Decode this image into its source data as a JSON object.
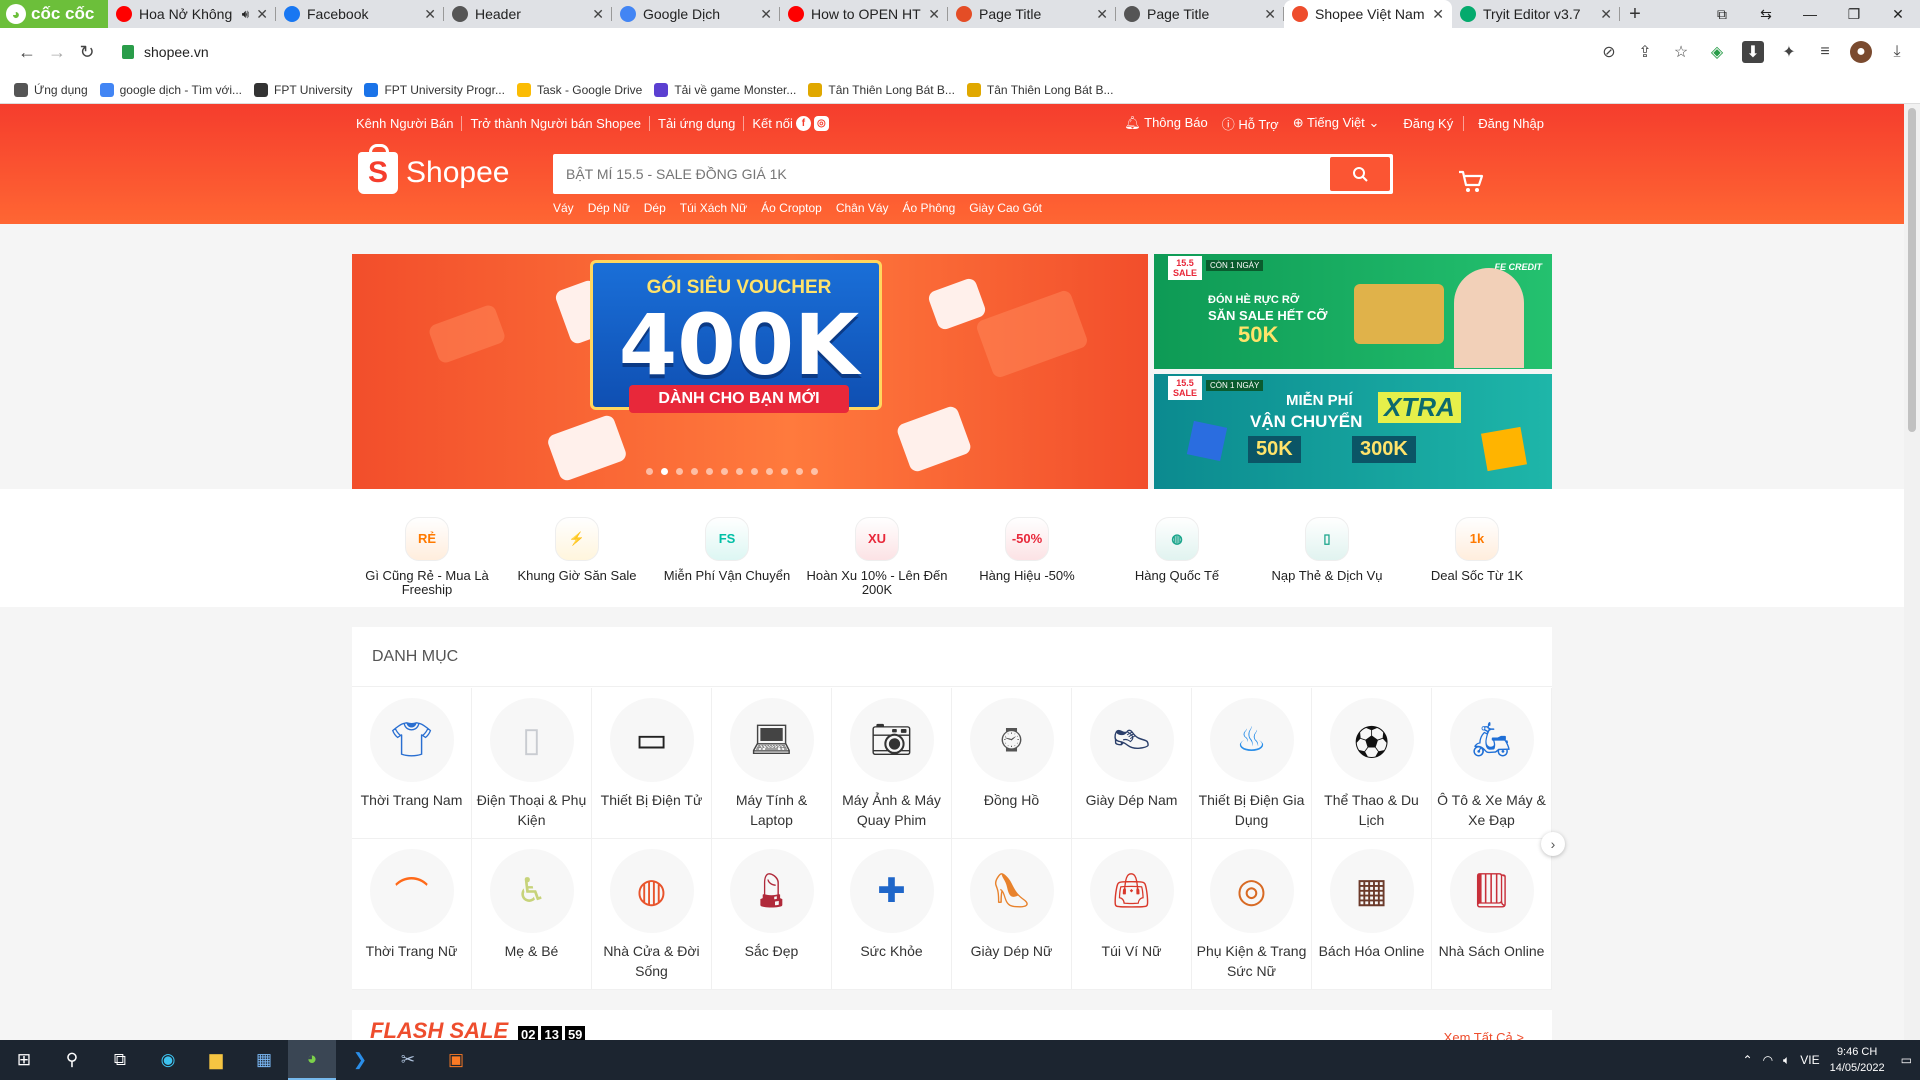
{
  "browser": {
    "brand": "cốc cốc",
    "tabs": [
      {
        "title": "Hoa Nở Không",
        "icon": "youtube-icon",
        "color": "#ff0000",
        "audio": true
      },
      {
        "title": "Facebook",
        "icon": "facebook-icon",
        "color": "#1877f2"
      },
      {
        "title": "Header",
        "icon": "globe-icon",
        "color": "#555555"
      },
      {
        "title": "Google Dịch",
        "icon": "google-translate-icon",
        "color": "#4285f4"
      },
      {
        "title": "How to OPEN HT",
        "icon": "youtube-icon",
        "color": "#ff0000"
      },
      {
        "title": "Page Title",
        "icon": "html-icon",
        "color": "#e44d26"
      },
      {
        "title": "Page Title",
        "icon": "globe-icon",
        "color": "#555555"
      },
      {
        "title": "Shopee Việt Nam",
        "icon": "shopee-icon",
        "color": "#ee4d2d",
        "active": true
      },
      {
        "title": "Tryit Editor v3.7",
        "icon": "w3schools-icon",
        "color": "#04aa6d"
      }
    ],
    "url": "shopee.vn",
    "bookmarks": [
      {
        "label": "Ứng dụng",
        "color": "#555555"
      },
      {
        "label": "google dịch - Tìm với...",
        "color": "#4285f4"
      },
      {
        "label": "FPT University",
        "color": "#333333"
      },
      {
        "label": "FPT University Progr...",
        "color": "#1a73e8"
      },
      {
        "label": "Task - Google Drive",
        "color": "#fbbc04"
      },
      {
        "label": "Tải về game Monster...",
        "color": "#5b3fd1"
      },
      {
        "label": "Tân Thiên Long Bát B...",
        "color": "#e0a800"
      },
      {
        "label": "Tân Thiên Long Bát B...",
        "color": "#e0a800"
      }
    ]
  },
  "shopee": {
    "topnav_left": [
      "Kênh Người Bán",
      "Trở thành Người bán Shopee",
      "Tải ứng dụng",
      "Kết nối"
    ],
    "topnav_right": {
      "notify": "Thông Báo",
      "help": "Hỗ Trợ",
      "lang": "Tiếng Việt",
      "register": "Đăng Ký",
      "login": "Đăng Nhập"
    },
    "logo_text": "Shopee",
    "search_placeholder": "BẬT MÍ 15.5 - SALE ĐỒNG GIÁ 1K",
    "keywords": [
      "Váy",
      "Dép Nữ",
      "Dép",
      "Túi Xách Nữ",
      "Áo Croptop",
      "Chân Váy",
      "Áo Phông",
      "Giày Cao Gót"
    ],
    "brand_color": "#ee4d2d"
  },
  "banners": {
    "main": {
      "title": "GÓI SIÊU VOUCHER",
      "amount": "400K",
      "subtitle": "DÀNH CHO BẠN MỚI",
      "dots": 12,
      "active_dot": 1
    },
    "side1": {
      "sale": "15.5 SALE",
      "tag": "CÒN 1 NGÀY",
      "partner": "FE CREDIT",
      "line1": "ĐÓN HÈ RỰC RỠ",
      "line2": "SĂN SALE HẾT CỠ",
      "discount": "50K"
    },
    "side2": {
      "sale": "15.5 SALE",
      "tag": "CÒN 1 NGÀY",
      "line1": "MIỄN PHÍ",
      "line2": "VẬN CHUYỂN",
      "xtra": "XTRA",
      "v1": "50K",
      "v2": "300K"
    }
  },
  "quick_links": [
    {
      "label": "Gì Cũng Rẻ - Mua Là Freeship",
      "icon": "re-icon",
      "color": "#ff7a00"
    },
    {
      "label": "Khung Giờ Săn Sale",
      "icon": "lightning-icon",
      "color": "#ffb400"
    },
    {
      "label": "Miễn Phí Vận Chuyển",
      "icon": "freeship-icon",
      "color": "#00bfa5"
    },
    {
      "label": "Hoàn Xu 10% - Lên Đến 200K",
      "icon": "coin-cashback-icon",
      "color": "#e8283a"
    },
    {
      "label": "Hàng Hiệu -50%",
      "icon": "brand-sale-icon",
      "color": "#e8283a"
    },
    {
      "label": "Hàng Quốc Tế",
      "icon": "globe-icon",
      "color": "#1aa58b"
    },
    {
      "label": "Nạp Thẻ & Dịch Vụ",
      "icon": "phone-icon",
      "color": "#1aa58b"
    },
    {
      "label": "Deal Sốc Từ 1K",
      "icon": "deal-1k-icon",
      "color": "#ff7a00"
    }
  ],
  "categories": {
    "heading": "DANH MỤC",
    "items": [
      {
        "label": "Thời Trang Nam",
        "icon": "polo-shirt-icon"
      },
      {
        "label": "Điện Thoại & Phụ Kiện",
        "icon": "smartphone-icon"
      },
      {
        "label": "Thiết Bị Điện Tử",
        "icon": "tv-icon"
      },
      {
        "label": "Máy Tính & Laptop",
        "icon": "laptop-icon"
      },
      {
        "label": "Máy Ảnh & Máy Quay Phim",
        "icon": "camera-icon"
      },
      {
        "label": "Đồng Hồ",
        "icon": "watch-icon"
      },
      {
        "label": "Giày Dép Nam",
        "icon": "mens-shoe-icon"
      },
      {
        "label": "Thiết Bị Điện Gia Dụng",
        "icon": "kettle-icon"
      },
      {
        "label": "Thể Thao & Du Lịch",
        "icon": "soccer-ball-icon"
      },
      {
        "label": "Ô Tô & Xe Máy & Xe Đạp",
        "icon": "scooter-icon"
      },
      {
        "label": "Thời Trang Nữ",
        "icon": "tank-top-icon"
      },
      {
        "label": "Mẹ & Bé",
        "icon": "high-chair-icon"
      },
      {
        "label": "Nhà Cửa & Đời Sống",
        "icon": "cooking-pot-icon"
      },
      {
        "label": "Sắc Đẹp",
        "icon": "lipstick-palette-icon"
      },
      {
        "label": "Sức Khỏe",
        "icon": "face-mask-icon"
      },
      {
        "label": "Giày Dép Nữ",
        "icon": "high-heel-icon"
      },
      {
        "label": "Túi Ví Nữ",
        "icon": "handbag-icon"
      },
      {
        "label": "Phụ Kiện & Trang Sức Nữ",
        "icon": "belt-icon"
      },
      {
        "label": "Bách Hóa Online",
        "icon": "chocolate-icon"
      },
      {
        "label": "Nhà Sách Online",
        "icon": "book-icon"
      }
    ]
  },
  "flash_sale": {
    "title": "FLASH SALE",
    "timer": [
      "02",
      "13",
      "59"
    ],
    "see_all": "Xem Tất Cả >"
  },
  "taskbar": {
    "lang": "VIE",
    "time": "9:46 CH",
    "date": "14/05/2022"
  }
}
